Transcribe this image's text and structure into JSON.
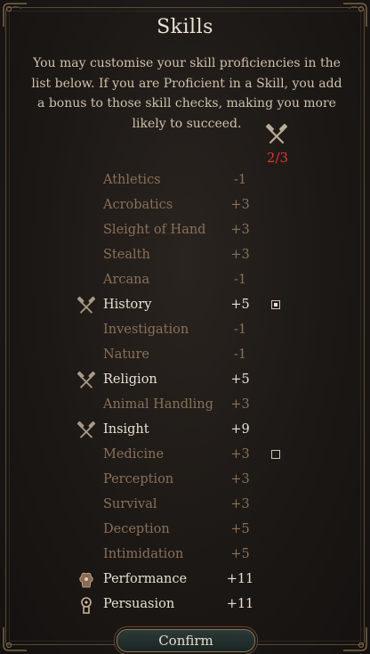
{
  "window": {
    "title": "Skills",
    "description": "You may customise your skill proficiencies in the list below. If you are Proficient in a Skill, you add a bonus to those skill checks, making you more likely to succeed.",
    "proficiency_count": "2/3",
    "confirm_label": "Confirm"
  },
  "skills": [
    {
      "name": "Athletics",
      "value": "-1",
      "proficient": false,
      "icon": null,
      "checkbox": null
    },
    {
      "name": "Acrobatics",
      "value": "+3",
      "proficient": false,
      "icon": null,
      "checkbox": null
    },
    {
      "name": "Sleight of Hand",
      "value": "+3",
      "proficient": false,
      "icon": null,
      "checkbox": null
    },
    {
      "name": "Stealth",
      "value": "+3",
      "proficient": false,
      "icon": null,
      "checkbox": null
    },
    {
      "name": "Arcana",
      "value": "-1",
      "proficient": false,
      "icon": null,
      "checkbox": null
    },
    {
      "name": "History",
      "value": "+5",
      "proficient": true,
      "icon": "crossed-hammers-icon",
      "checkbox": "checked"
    },
    {
      "name": "Investigation",
      "value": "-1",
      "proficient": false,
      "icon": null,
      "checkbox": null
    },
    {
      "name": "Nature",
      "value": "-1",
      "proficient": false,
      "icon": null,
      "checkbox": null
    },
    {
      "name": "Religion",
      "value": "+5",
      "proficient": true,
      "icon": "crossed-hammers-icon",
      "checkbox": null
    },
    {
      "name": "Animal Handling",
      "value": "+3",
      "proficient": false,
      "icon": null,
      "checkbox": null
    },
    {
      "name": "Insight",
      "value": "+9",
      "proficient": true,
      "icon": "crossed-hammers-icon",
      "checkbox": null
    },
    {
      "name": "Medicine",
      "value": "+3",
      "proficient": false,
      "icon": null,
      "checkbox": "unchecked"
    },
    {
      "name": "Perception",
      "value": "+3",
      "proficient": false,
      "icon": null,
      "checkbox": null
    },
    {
      "name": "Survival",
      "value": "+3",
      "proficient": false,
      "icon": null,
      "checkbox": null
    },
    {
      "name": "Deception",
      "value": "+5",
      "proficient": false,
      "icon": null,
      "checkbox": null
    },
    {
      "name": "Intimidation",
      "value": "+5",
      "proficient": false,
      "icon": null,
      "checkbox": null
    },
    {
      "name": "Performance",
      "value": "+11",
      "proficient": true,
      "icon": "background-performance-icon",
      "checkbox": null
    },
    {
      "name": "Persuasion",
      "value": "+11",
      "proficient": true,
      "icon": "background-persuasion-icon",
      "checkbox": null
    }
  ],
  "colors": {
    "proficient_text": "#e8e0d2",
    "non_proficient_text": "#8a7058",
    "count_red": "#d83a3a"
  }
}
